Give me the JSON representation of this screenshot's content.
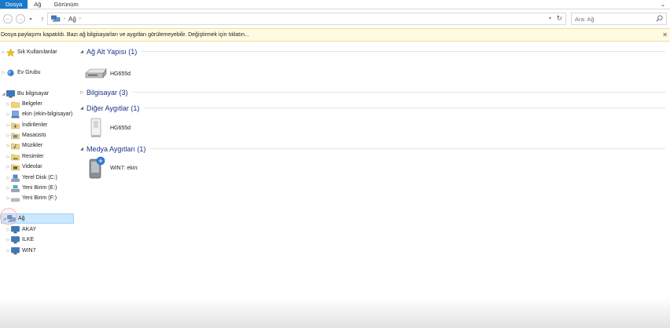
{
  "ribbon": {
    "tabs": [
      "Dosya",
      "Ağ",
      "Görünüm"
    ],
    "active": 0,
    "help_glyph": "⌄"
  },
  "address": {
    "crumb": "Ağ",
    "refresh_glyph": "↻"
  },
  "search": {
    "placeholder": "Ara: Ağ"
  },
  "infobar": {
    "message": "Dosya paylaşımı kapatıldı. Bazı ağ bilgisayarları ve aygıtları görülemeyebilir. Değiştirmek için tıklatın...",
    "close_glyph": "✕"
  },
  "nav": {
    "quick_access": "Sık Kullanılanlar",
    "homegroup": "Ev Grubu",
    "this_pc": "Bu bilgisayar",
    "this_pc_children": [
      "Belgeler",
      "ekin (ekin-bilgisayar)",
      "İndirilenler",
      "Masaüstü",
      "Müzikler",
      "Resimler",
      "Videolar",
      "Yerel Disk (C:)",
      "Yeni Birim (E:)",
      "Yeni Birim (F:)"
    ],
    "network": "Ağ",
    "network_children": [
      "AKAY",
      "ILKE",
      "WIN7"
    ]
  },
  "groups": [
    {
      "title": "Ağ Alt Yapısı (1)",
      "items": [
        "HG655d"
      ]
    },
    {
      "title": "Bilgisayar (3)",
      "items": []
    },
    {
      "title": "Diğer Aygıtlar (1)",
      "items": [
        "HG655d"
      ]
    },
    {
      "title": "Medya Aygıtları (1)",
      "items": [
        "WIN7: ekin:"
      ]
    }
  ],
  "colors": {
    "accent": "#1979ca",
    "group_title": "#1e3287",
    "infobar_bg": "#fffbe1",
    "selection": "#cce8ff"
  }
}
